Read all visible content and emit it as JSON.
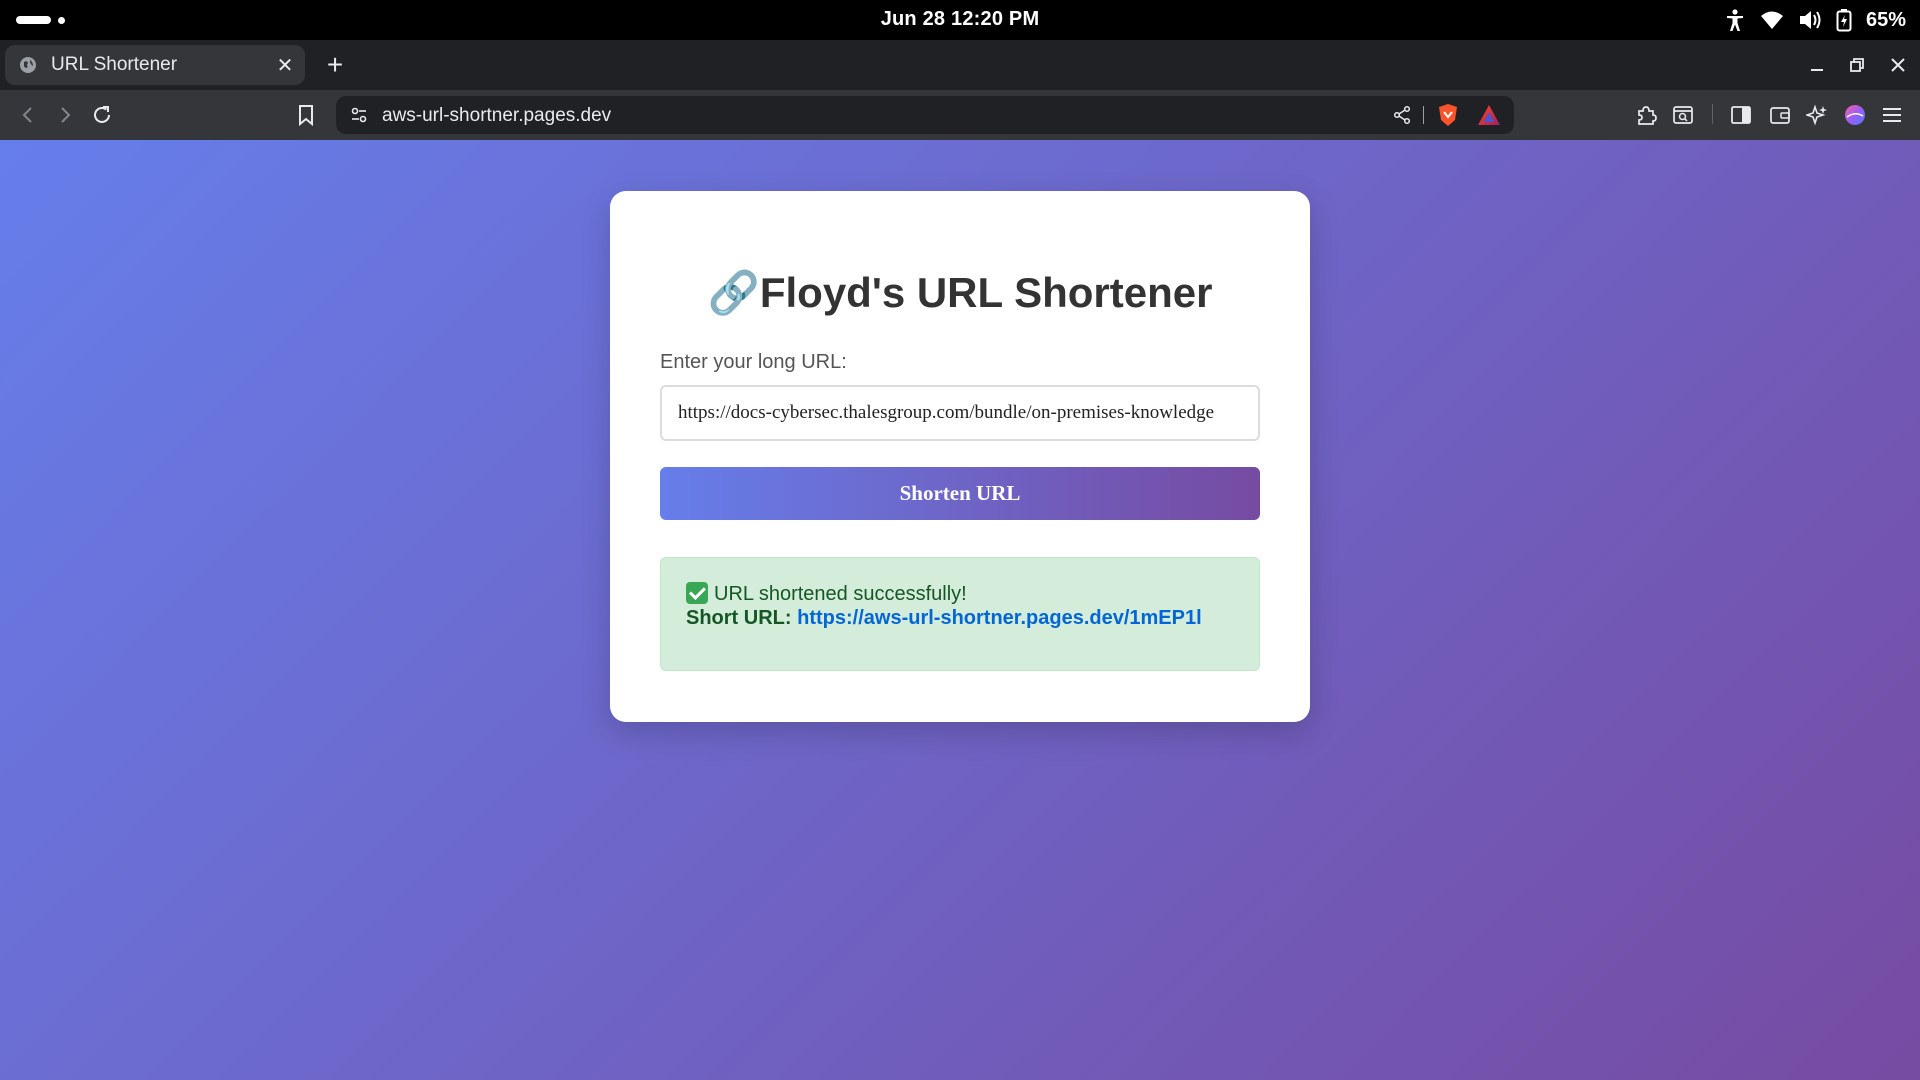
{
  "status_bar": {
    "datetime": "Jun 28  12:20 PM",
    "battery": "65%",
    "icons": [
      "accessibility-icon",
      "wifi-icon",
      "volume-icon",
      "battery-icon"
    ]
  },
  "browser": {
    "tab": {
      "title": "URL Shortener",
      "close_glyph": "✕"
    },
    "new_tab_glyph": "+",
    "address": "aws-url-shortner.pages.dev"
  },
  "page": {
    "title": "Floyd's URL Shortener",
    "title_icon": "🔗",
    "input_label": "Enter your long URL:",
    "input_value": "https://docs-cybersec.thalesgroup.com/bundle/on-premises-knowledge",
    "button_label": "Shorten URL",
    "result": {
      "success_text": "URL shortened successfully!",
      "short_label": "Short URL:",
      "short_url": "https://aws-url-shortner.pages.dev/1mEP1l"
    }
  },
  "colors": {
    "gradient_start": "#667eea",
    "gradient_end": "#764ba2",
    "success_bg": "#d4edda",
    "success_text": "#155724",
    "link": "#0366d6"
  }
}
